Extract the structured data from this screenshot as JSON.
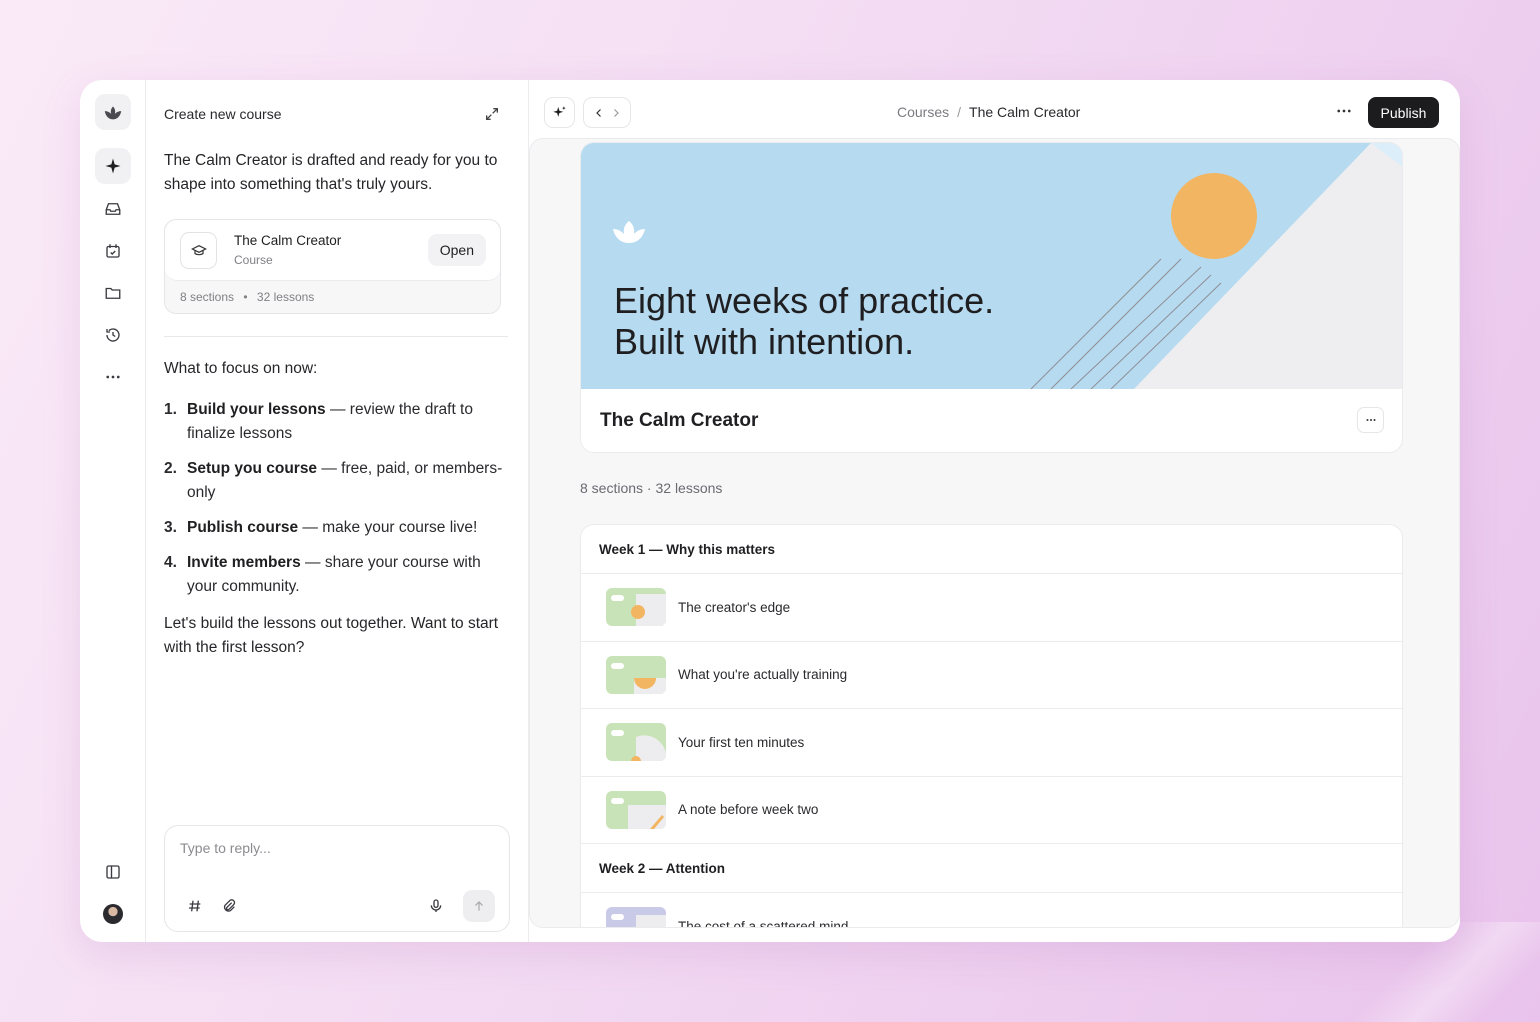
{
  "sidebar": {
    "icons": [
      "logo-icon",
      "sparkle-icon",
      "inbox-icon",
      "calendar-icon",
      "folder-icon",
      "history-icon",
      "more-icon",
      "panel-toggle-icon",
      "avatar"
    ]
  },
  "chat": {
    "title": "Create new course",
    "intro": "The Calm Creator is drafted and ready for you to shape into something that's truly yours.",
    "course_card": {
      "name": "The Calm Creator",
      "type": "Course",
      "open_label": "Open",
      "sections": "8 sections",
      "lessons": "32 lessons"
    },
    "focus_heading": "What to focus on now:",
    "steps": [
      {
        "num": "1.",
        "bold": "Build your lessons",
        "text": " — review the draft to finalize lessons"
      },
      {
        "num": "2.",
        "bold": "Setup you course",
        "text": " — free, paid, or members-only"
      },
      {
        "num": "3.",
        "bold": "Publish course",
        "text": " — make your course live!"
      },
      {
        "num": "4.",
        "bold": "Invite members",
        "text": " — share your course with your community."
      }
    ],
    "outro": "Let's build the lessons out together. Want to start with the first lesson?",
    "reply_placeholder": "Type to reply..."
  },
  "toolbar": {
    "breadcrumb_root": "Courses",
    "breadcrumb_separator": "/",
    "breadcrumb_current": "The Calm Creator",
    "publish_label": "Publish"
  },
  "course": {
    "banner_line1": "Eight weeks of practice.",
    "banner_line2": "Built with intention.",
    "title": "The Calm Creator",
    "stats": "8 sections · 32 lessons",
    "colors": {
      "banner": "#b6daf0",
      "sun": "#f2b562",
      "thumb": "#c9e3b8"
    }
  },
  "sections": [
    {
      "title": "Week 1 — Why this matters",
      "lessons": [
        "The creator's edge",
        "What you're actually training",
        "Your first ten minutes",
        "A note before week two"
      ]
    },
    {
      "title": "Week 2 — Attention",
      "lessons": [
        "The cost of a scattered mind"
      ]
    }
  ]
}
